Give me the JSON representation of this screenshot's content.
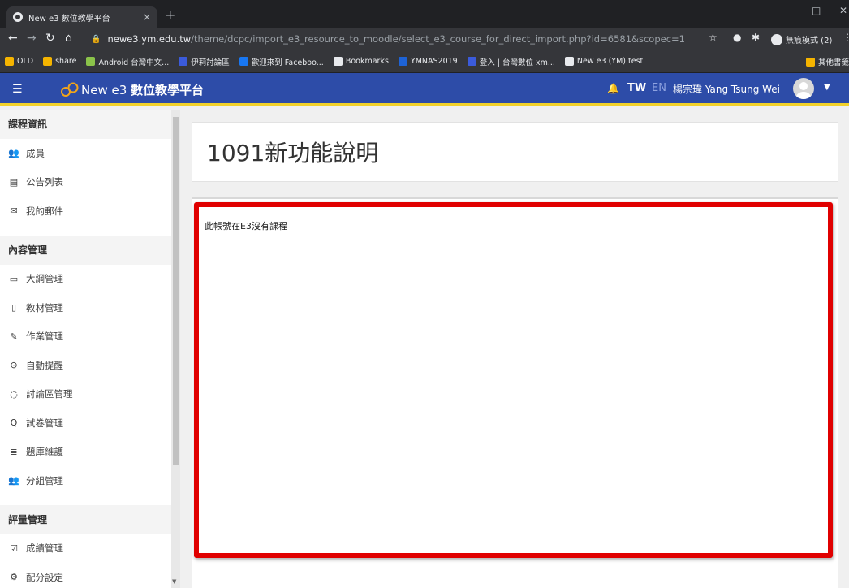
{
  "browser": {
    "tab_title": "New e3 數位教學平台",
    "tab_close": "×",
    "new_tab": "+",
    "window_controls": {
      "minimize": "–",
      "maximize": "□",
      "close": "✕"
    },
    "url_host": "newe3.ym.edu.tw",
    "url_path": "/theme/dcpc/import_e3_resource_to_moodle/select_e3_course_for_direct_import.php?id=6581&scopec=1",
    "incognito_label": "無痕模式 (2)",
    "bookmarks": [
      {
        "label": "OLD",
        "color": "#f5b400"
      },
      {
        "label": "share",
        "color": "#f5b400"
      },
      {
        "label": "Android 台灣中文...",
        "color": "#8bc34a"
      },
      {
        "label": "伊莉討論區",
        "color": "#3b5bdb"
      },
      {
        "label": "歡迎來到 Faceboo...",
        "color": "#1877f2"
      },
      {
        "label": "Bookmarks",
        "color": "#e8eaed"
      },
      {
        "label": "YMNAS2019",
        "color": "#1e63d6"
      },
      {
        "label": "登入 | 台灣數位 xm...",
        "color": "#3b5bdb"
      },
      {
        "label": "New e3 (YM) test",
        "color": "#e8eaed"
      }
    ],
    "other_bookmarks": "其他書籤"
  },
  "header": {
    "brand_prefix": "New e3 ",
    "brand_bold": "數位教學平台",
    "lang_tw": "TW",
    "lang_en": "EN",
    "username": "楊宗瑋 Yang Tsung Wei"
  },
  "sidebar": {
    "sections": [
      {
        "title": "課程資訊",
        "items": [
          {
            "icon": "👥",
            "label": "成員"
          },
          {
            "icon": "▤",
            "label": "公告列表"
          },
          {
            "icon": "✉",
            "label": "我的郵件"
          }
        ]
      },
      {
        "title": "內容管理",
        "items": [
          {
            "icon": "▭",
            "label": "大綱管理"
          },
          {
            "icon": "▯",
            "label": "教材管理"
          },
          {
            "icon": "✎",
            "label": "作業管理"
          },
          {
            "icon": "⊙",
            "label": "自動提醒"
          },
          {
            "icon": "◌",
            "label": "討論區管理"
          },
          {
            "icon": "Q",
            "label": "試卷管理"
          },
          {
            "icon": "≣",
            "label": "題庫維護"
          },
          {
            "icon": "👥",
            "label": "分組管理"
          }
        ]
      },
      {
        "title": "評量管理",
        "items": [
          {
            "icon": "☑",
            "label": "成績管理"
          },
          {
            "icon": "⚙",
            "label": "配分設定"
          }
        ]
      }
    ]
  },
  "main": {
    "page_title": "1091新功能說明",
    "message": "此帳號在E3沒有課程"
  },
  "colors": {
    "header_bg": "#2d4ca8",
    "header_accent": "#f2d12a",
    "highlight_border": "#e00000"
  }
}
